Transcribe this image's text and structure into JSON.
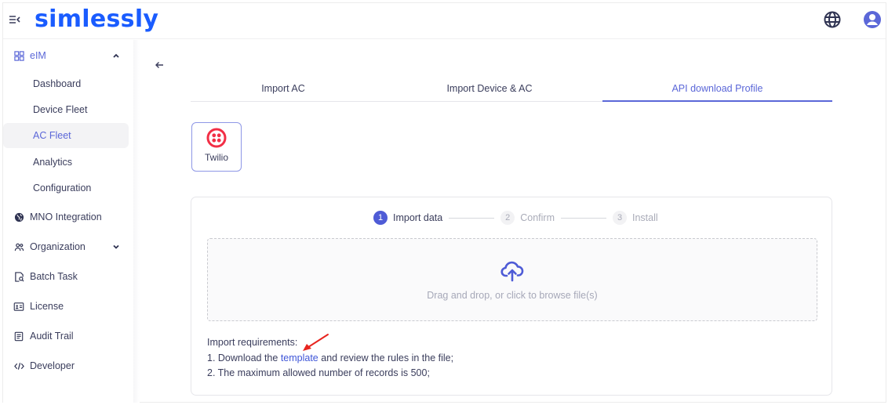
{
  "app": {
    "brand": "simlessly",
    "brand_color": "#1a5cff",
    "accent_color": "#5b67d8",
    "icons": {
      "menu_toggle": "menu-collapse-icon",
      "language": "globe-icon",
      "account": "user-circle-icon"
    }
  },
  "sidebar": {
    "groups": [
      {
        "label": "eIM",
        "icon": "grid-icon",
        "expanded": true,
        "children": [
          {
            "label": "Dashboard",
            "active": false
          },
          {
            "label": "Device Fleet",
            "active": false
          },
          {
            "label": "AC Fleet",
            "active": true
          },
          {
            "label": "Analytics",
            "active": false
          },
          {
            "label": "Configuration",
            "active": false
          }
        ]
      }
    ],
    "items": [
      {
        "label": "MNO Integration",
        "icon": "globe-icon"
      },
      {
        "label": "Organization",
        "icon": "users-icon",
        "expandable": true
      },
      {
        "label": "Batch Task",
        "icon": "file-search-icon"
      },
      {
        "label": "License",
        "icon": "id-card-icon"
      },
      {
        "label": "Audit Trail",
        "icon": "document-list-icon"
      },
      {
        "label": "Developer",
        "icon": "code-icon"
      }
    ]
  },
  "main": {
    "back_icon": "arrow-left-icon",
    "tabs": [
      {
        "label": "Import AC",
        "active": false
      },
      {
        "label": "Import Device & AC",
        "active": false
      },
      {
        "label": "API download Profile",
        "active": true
      }
    ],
    "providers": [
      {
        "label": "Twilio",
        "icon": "twilio-logo-icon",
        "selected": true,
        "color": "#f22f46"
      }
    ],
    "steps": [
      {
        "num": "1",
        "label": "Import data",
        "active": true
      },
      {
        "num": "2",
        "label": "Confirm",
        "active": false
      },
      {
        "num": "3",
        "label": "Install",
        "active": false
      }
    ],
    "dropzone": {
      "icon": "cloud-upload-icon",
      "hint": "Drag and drop, or click to browse file(s)"
    },
    "requirements": {
      "title": "Import requirements:",
      "line1_prefix": "1. Download the ",
      "line1_link": "template",
      "line1_suffix": " and review the rules in the file;",
      "line2": "2. The maximum allowed number of records is 500;"
    },
    "annotation": {
      "icon": "red-arrow-annotation",
      "color": "#e8251f"
    }
  }
}
